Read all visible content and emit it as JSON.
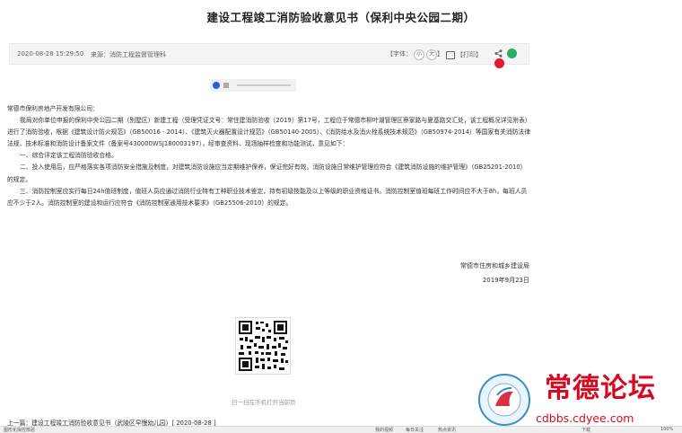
{
  "page": {
    "title": "建设工程竣工消防验收意见书（保利中央公园二期）"
  },
  "meta": {
    "date": "2020-08-28 15:29:50",
    "source": "来源：消防工程监督管理科",
    "font_label": "【字体：",
    "font_small": "小",
    "font_large": "大",
    "font_close": "】",
    "print": "【打印】",
    "share_icons": [
      "share-icon",
      "wechat-icon",
      "weibo-icon"
    ]
  },
  "article": {
    "salutation": "常德市保利房地产开发有限公司：",
    "paragraphs": [
      "我局对你单位申报的保利中央公园二期（别墅区）新建工程（受理凭证文号：常住建消防验收〔2019〕第17号，工程位于常德市柳叶湖管理区蔡家路与夏基路交汇处，该工程概况详见附表）进行了消防验收，根据《建筑设计防火规范》（GB50016 - 2014）、《建筑灭火器配置设计规范》（GB50140-2005）、《消防给水及消火栓系统技术规范》（GB50974-2014）等国家有关消防法律法规、技术标准和消防设计备案文件（备案号430000WSJ180003197），经审查资料、现场抽样检查和功能测试，意见如下：",
      "一、综合评定该工程消防验收合格。",
      "二、投入使用后，应严格落实各项消防安全措施及制度，对建筑消防设施应当定期维护保养，保证完好有效。消防设施日常维护管理应符合《建筑消防设施的维护管理》（GB25201-2010）的规定。",
      "三、消防控制室应实行每日24h值班制度，值班人员应通过消防行业特有工种职业技术鉴定，持有初级技能及以上等级的职业资格证书。消防控制室值班每班工作时间应不大于8h，每班人员应不少于2人。消防控制室的建设和运行应符合《消防控制室通用技术要求》（GB25506-2010）的规定。"
    ],
    "signature": "常德市住房和城乡建设局",
    "sign_date": "2019年9月23日"
  },
  "qr": {
    "caption": "扫一扫在手机打开当前页"
  },
  "nav": {
    "prev": "上一篇：建设工程竣工消防验收意见书（武陵区早慢幼儿园）[ 2020-08-28 ]"
  },
  "status_bar": {
    "left": "图形化操控核验",
    "items": [
      "我的视频",
      "每日关注",
      "热点资讯",
      "下载",
      "100%"
    ]
  },
  "watermark": {
    "name": "常德论坛",
    "url": "cdbbs.cdyee.com",
    "ring_text": "cdbbs.cdyee.com"
  },
  "colors": {
    "watermark_red": "#d30b22",
    "wechat_green": "#2aae67",
    "weibo_red": "#e6162d",
    "play_blue": "#2b5fd9"
  }
}
